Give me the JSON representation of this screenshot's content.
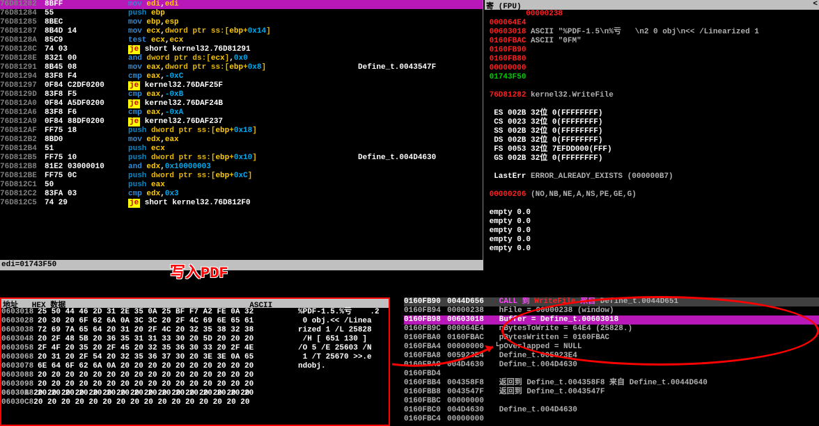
{
  "annotation": "写入PDF",
  "status_bar": "edi=01743F50",
  "regs_panel_title": "寄 (FPU)",
  "disasm": [
    {
      "addr": "76D81282",
      "bytes": "8BFF",
      "instr": {
        "op": "mov",
        "args": "edi,edi"
      },
      "cmt": "",
      "hl": true
    },
    {
      "addr": "76D81284",
      "bytes": "55",
      "instr": {
        "op": "push",
        "args": "ebp"
      },
      "cmt": ""
    },
    {
      "addr": "76D81285",
      "bytes": "8BEC",
      "instr": {
        "op": "mov",
        "args": "ebp,esp"
      },
      "cmt": ""
    },
    {
      "addr": "76D81287",
      "bytes": "8B4D 14",
      "instr": {
        "op": "mov",
        "args": "ecx,dword ptr ss:[ebp+0x14]"
      },
      "cmt": ""
    },
    {
      "addr": "76D8128A",
      "bytes": "85C9",
      "instr": {
        "op": "test",
        "args": "ecx,ecx"
      },
      "cmt": ""
    },
    {
      "addr": "76D8128C",
      "bytes": "74 03",
      "instr": {
        "op": "je",
        "args": "short kernel32.76D81291"
      },
      "cmt": ""
    },
    {
      "addr": "76D8128E",
      "bytes": "8321 00",
      "instr": {
        "op": "and",
        "args": "dword ptr ds:[ecx],0x0"
      },
      "cmt": ""
    },
    {
      "addr": "76D81291",
      "bytes": "8B45 08",
      "instr": {
        "op": "mov",
        "args": "eax,dword ptr ss:[ebp+0x8]"
      },
      "cmt": "Define_t.0043547F"
    },
    {
      "addr": "76D81294",
      "bytes": "83F8 F4",
      "instr": {
        "op": "cmp",
        "args": "eax,-0xC"
      },
      "cmt": ""
    },
    {
      "addr": "76D81297",
      "bytes": "0F84 C2DF0200",
      "instr": {
        "op": "je",
        "args": "kernel32.76DAF25F"
      },
      "cmt": ""
    },
    {
      "addr": "76D8129D",
      "bytes": "83F8 F5",
      "instr": {
        "op": "cmp",
        "args": "eax,-0xB"
      },
      "cmt": ""
    },
    {
      "addr": "76D812A0",
      "bytes": "0F84 A5DF0200",
      "instr": {
        "op": "je",
        "args": "kernel32.76DAF24B"
      },
      "cmt": ""
    },
    {
      "addr": "76D812A6",
      "bytes": "83F8 F6",
      "instr": {
        "op": "cmp",
        "args": "eax,-0xA"
      },
      "cmt": ""
    },
    {
      "addr": "76D812A9",
      "bytes": "0F84 88DF0200",
      "instr": {
        "op": "je",
        "args": "kernel32.76DAF237"
      },
      "cmt": ""
    },
    {
      "addr": "76D812AF",
      "bytes": "FF75 18",
      "instr": {
        "op": "push",
        "args": "dword ptr ss:[ebp+0x18]"
      },
      "cmt": ""
    },
    {
      "addr": "76D812B2",
      "bytes": "8BD0",
      "instr": {
        "op": "mov",
        "args": "edx,eax"
      },
      "cmt": ""
    },
    {
      "addr": "76D812B4",
      "bytes": "51",
      "instr": {
        "op": "push",
        "args": "ecx"
      },
      "cmt": ""
    },
    {
      "addr": "76D812B5",
      "bytes": "FF75 10",
      "instr": {
        "op": "push",
        "args": "dword ptr ss:[ebp+0x10]"
      },
      "cmt": "Define_t.004D4630"
    },
    {
      "addr": "76D812B8",
      "bytes": "81E2 03000010",
      "instr": {
        "op": "and",
        "args": "edx,0x10000003"
      },
      "cmt": ""
    },
    {
      "addr": "76D812BE",
      "bytes": "FF75 0C",
      "instr": {
        "op": "push",
        "args": "dword ptr ss:[ebp+0xC]"
      },
      "cmt": ""
    },
    {
      "addr": "76D812C1",
      "bytes": "50",
      "instr": {
        "op": "push",
        "args": "eax"
      },
      "cmt": ""
    },
    {
      "addr": "76D812C2",
      "bytes": "83FA 03",
      "instr": {
        "op": "cmp",
        "args": "edx,0x3"
      },
      "cmt": ""
    },
    {
      "addr": "76D812C5",
      "bytes": "74 29",
      "instr": {
        "op": "je",
        "args": "short kernel32.76D812F0"
      },
      "cmt": ""
    }
  ],
  "regs": [
    {
      "t": "val",
      "label": "",
      "val": "00000238",
      "cls": "red"
    },
    {
      "t": "val",
      "label": "",
      "val": "000064E4",
      "cls": "red"
    },
    {
      "t": "ascii",
      "label": "00603018",
      "val": "ASCII \"%PDF-1.5\\n%亏   \\n2 0 obj\\n<< /Linearized 1 ",
      "lcls": "red"
    },
    {
      "t": "ascii",
      "label": "0160FBAC",
      "val": "ASCII \"0FM\"",
      "lcls": "red"
    },
    {
      "t": "val",
      "label": "",
      "val": "0160FB90",
      "cls": "red"
    },
    {
      "t": "val",
      "label": "",
      "val": "0160FB80",
      "cls": "red"
    },
    {
      "t": "val",
      "label": "",
      "val": "00000000",
      "cls": "red"
    },
    {
      "t": "val",
      "label": "",
      "val": "01743F50",
      "cls": "green"
    },
    {
      "t": "blank"
    },
    {
      "t": "eip",
      "label": "76D81282",
      "val": "kernel32.WriteFile"
    },
    {
      "t": "blank"
    },
    {
      "t": "seg",
      "name": "ES",
      "val": "002B",
      "w": "32位",
      "range": "0(FFFFFFFF)"
    },
    {
      "t": "seg",
      "name": "CS",
      "val": "0023",
      "w": "32位",
      "range": "0(FFFFFFFF)"
    },
    {
      "t": "seg",
      "name": "SS",
      "val": "002B",
      "w": "32位",
      "range": "0(FFFFFFFF)"
    },
    {
      "t": "seg",
      "name": "DS",
      "val": "002B",
      "w": "32位",
      "range": "0(FFFFFFFF)"
    },
    {
      "t": "seg",
      "name": "FS",
      "val": "0053",
      "w": "32位",
      "range": "7EFDD000(FFF)"
    },
    {
      "t": "seg",
      "name": "GS",
      "val": "002B",
      "w": "32位",
      "range": "0(FFFFFFFF)"
    },
    {
      "t": "blank"
    },
    {
      "t": "err",
      "label": "LastErr",
      "val": "ERROR_ALREADY_EXISTS (000000B7)"
    },
    {
      "t": "blank"
    },
    {
      "t": "efl",
      "label": "00000206",
      "val": "(NO,NB,NE,A,NS,PE,GE,G)"
    },
    {
      "t": "blank"
    },
    {
      "t": "fpu",
      "val": "empty 0.0"
    },
    {
      "t": "fpu",
      "val": "empty 0.0"
    },
    {
      "t": "fpu",
      "val": "empty 0.0"
    },
    {
      "t": "fpu",
      "val": "empty 0.0"
    },
    {
      "t": "fpu",
      "val": "empty 0.0"
    }
  ],
  "stack": [
    {
      "a": "0160FB90",
      "v": "0044D656",
      "txt": "CALL 到 WriteFile 来自 Define_t.0044D651",
      "call": true,
      "bg": "sel"
    },
    {
      "a": "0160FB94",
      "v": "00000238",
      "txt": "hFile = 00000238 (window)"
    },
    {
      "a": "0160FB98",
      "v": "00603018",
      "txt": "Buffer = Define_t.00603018",
      "hl": true
    },
    {
      "a": "0160FB9C",
      "v": "000064E4",
      "txt": "nBytesToWrite = 64E4 (25828.)"
    },
    {
      "a": "0160FBA0",
      "v": "0160FBAC",
      "txt": "pBytesWritten = 0160FBAC"
    },
    {
      "a": "0160FBA4",
      "v": "00000000",
      "txt": "pOverlapped = NULL",
      "last": true
    },
    {
      "a": "0160FBA8",
      "v": "005923E4",
      "txt": "Define_t.005923E4"
    },
    {
      "a": "0160FBAC",
      "v": "004D4630",
      "txt": "Define_t.004D4630"
    },
    {
      "a": "0160FBD4",
      "v": "",
      "txt": ""
    },
    {
      "a": "0160FBB4",
      "v": "004358F8",
      "txt": "返回到 Define_t.004358F8 来自 Define_t.0044D640"
    },
    {
      "a": "0160FBB8",
      "v": "0043547F",
      "txt": "返回到 Define_t.0043547F"
    },
    {
      "a": "0160FBBC",
      "v": "00000000",
      "txt": ""
    },
    {
      "a": "0160FBC0",
      "v": "004D4630",
      "txt": "Define_t.004D4630"
    },
    {
      "a": "0160FBC4",
      "v": "00000000",
      "txt": ""
    }
  ],
  "dump_header": "地址   HEX 数据                                        ASCII",
  "dump": [
    {
      "a": "0603018",
      "h": "25 50 44 46 2D 31 2E 35 0A 25 BF F7 A2 FE 0A 32",
      "asc": "%PDF-1.5.%亏    .2"
    },
    {
      "a": "0603028",
      "h": "20 30 20 6F 62 6A 0A 3C 3C 20 2F 4C 69 6E 65 61",
      "asc": " 0 obj.<< /Linea"
    },
    {
      "a": "0603038",
      "h": "72 69 7A 65 64 20 31 20 2F 4C 20 32 35 38 32 38",
      "asc": "rized 1 /L 25828"
    },
    {
      "a": "0603048",
      "h": "20 2F 48 5B 20 36 35 31 31 33 30 20 5D 20 20 20",
      "asc": " /H [ 651 130 ] "
    },
    {
      "a": "0603058",
      "h": "2F 4F 20 35 20 2F 45 20 32 35 36 30 33 20 2F 4E",
      "asc": "/O 5 /E 25603 /N"
    },
    {
      "a": "0603068",
      "h": "20 31 20 2F 54 20 32 35 36 37 30 20 3E 3E 0A 65",
      "asc": " 1 /T 25670 >>.e"
    },
    {
      "a": "0603078",
      "h": "6E 64 6F 62 6A 0A 20 20 20 20 20 20 20 20 20 20",
      "asc": "ndobj.          "
    },
    {
      "a": "0603088",
      "h": "20 20 20 20 20 20 20 20 20 20 20 20 20 20 20 20",
      "asc": "                "
    },
    {
      "a": "0603098",
      "h": "20 20 20 20 20 20 20 20 20 20 20 20 20 20 20 20",
      "asc": "                "
    },
    {
      "a": "06030A8",
      "h": "20 20 20 20 20 20 20 20 20 20 20 20 20 20 20 20",
      "asc": "                "
    }
  ],
  "dump_extra": [
    {
      "a": "06030B8",
      "h": "20 20 20 20 20 20 20 20 20 20 20 20 20 20 20 20",
      "asc": "                "
    },
    {
      "a": "06030C8",
      "h": "20 20 20 20 20 20 20 20 20 20 20 20 20 20 20 20",
      "asc": "                "
    }
  ]
}
